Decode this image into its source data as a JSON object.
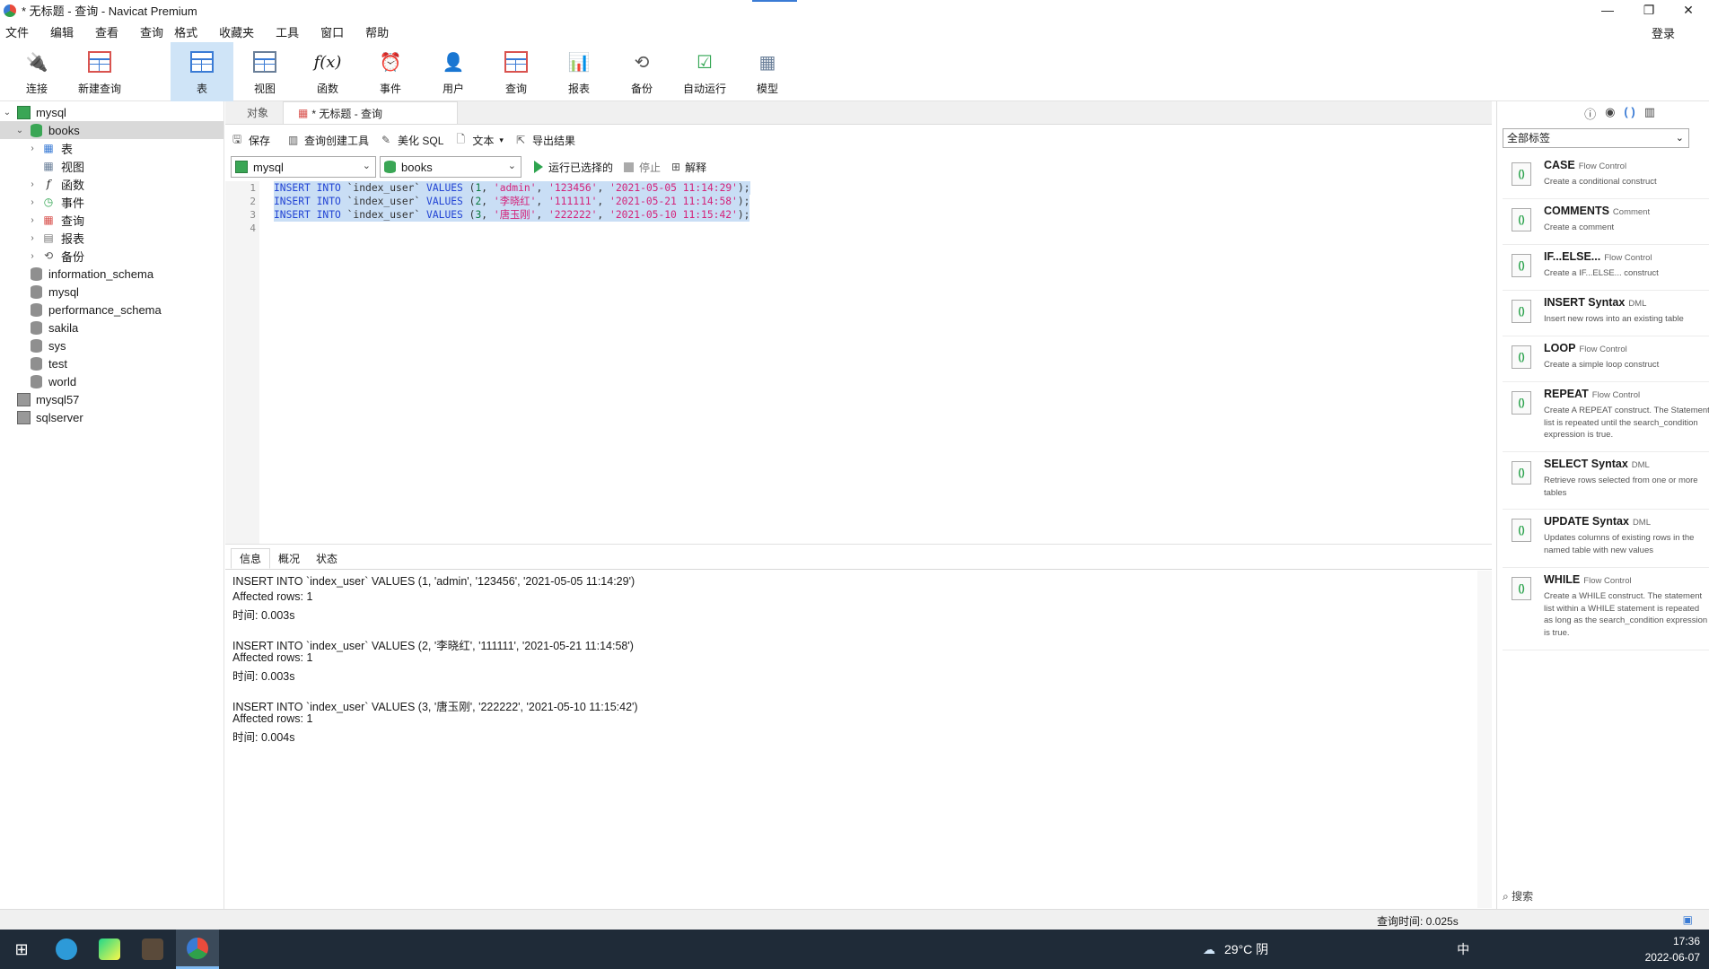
{
  "window": {
    "title": "* 无标题 - 查询 - Navicat Premium",
    "login": "登录",
    "minimize": "—",
    "maximize": "❐",
    "close": "✕"
  },
  "menu": [
    "文件",
    "编辑",
    "查看",
    "查询",
    "格式",
    "收藏夹",
    "工具",
    "窗口",
    "帮助"
  ],
  "toolbar": {
    "connect": "连接",
    "new_query": "新建查询",
    "table": "表",
    "view": "视图",
    "function": "函数",
    "event": "事件",
    "user": "用户",
    "query": "查询",
    "report": "报表",
    "backup": "备份",
    "automation": "自动运行",
    "model": "模型",
    "function_glyph": "f(x)"
  },
  "tree": {
    "conn_mysql": "mysql",
    "db_books": "books",
    "books_children": [
      "表",
      "视图",
      "函数",
      "事件",
      "查询",
      "报表",
      "备份"
    ],
    "other_dbs": [
      "information_schema",
      "mysql",
      "performance_schema",
      "sakila",
      "sys",
      "test",
      "world"
    ],
    "conn_mysql57": "mysql57",
    "conn_sqlserver": "sqlserver"
  },
  "tabs": {
    "objects": "对象",
    "query": "* 无标题 - 查询"
  },
  "query_toolbar": {
    "save": "保存",
    "builder": "查询创建工具",
    "beautify": "美化 SQL",
    "text": "文本",
    "export": "导出结果"
  },
  "selectors": {
    "connection": "mysql",
    "database": "books",
    "run_selected": "运行已选择的",
    "stop": "停止",
    "explain": "解释"
  },
  "editor": {
    "line_numbers": [
      "1",
      "2",
      "3",
      "4"
    ],
    "lines": [
      {
        "kw1": "INSERT INTO",
        "tbl": " `index_user` ",
        "kw2": "VALUES",
        "open": " (",
        "num": "1",
        "c1": ", ",
        "s1": "'admin'",
        "c2": ", ",
        "s2": "'123456'",
        "c3": ", ",
        "s3": "'2021-05-05 11:14:29'",
        "end": ");"
      },
      {
        "kw1": "INSERT INTO",
        "tbl": " `index_user` ",
        "kw2": "VALUES",
        "open": " (",
        "num": "2",
        "c1": ", ",
        "s1": "'李晓红'",
        "c2": ", ",
        "s2": "'111111'",
        "c3": ", ",
        "s3": "'2021-05-21 11:14:58'",
        "end": ");"
      },
      {
        "kw1": "INSERT INTO",
        "tbl": " `index_user` ",
        "kw2": "VALUES",
        "open": " (",
        "num": "3",
        "c1": ", ",
        "s1": "'唐玉刚'",
        "c2": ", ",
        "s2": "'222222'",
        "c3": ", ",
        "s3": "'2021-05-10 11:15:42'",
        "end": ");"
      }
    ]
  },
  "result_tabs": [
    "信息",
    "概况",
    "状态"
  ],
  "results": [
    "INSERT INTO `index_user` VALUES (1, 'admin', '123456', '2021-05-05 11:14:29')",
    "Affected rows: 1",
    "时间: 0.003s",
    "INSERT INTO `index_user` VALUES (2, '李晓红', '111111', '2021-05-21 11:14:58')",
    "Affected rows: 1",
    "时间: 0.003s",
    "INSERT INTO `index_user` VALUES (3, '唐玉刚', '222222', '2021-05-10 11:15:42')",
    "Affected rows: 1",
    "时间: 0.004s"
  ],
  "status": {
    "query_time": "查询时间: 0.025s"
  },
  "right_panel": {
    "dropdown": "全部标签",
    "search": "搜索",
    "snippets": [
      {
        "name": "CASE",
        "cat": "Flow Control",
        "desc": "Create a conditional construct"
      },
      {
        "name": "COMMENTS",
        "cat": "Comment",
        "desc": "Create a comment"
      },
      {
        "name": "IF...ELSE...",
        "cat": "Flow Control",
        "desc": "Create a IF...ELSE... construct"
      },
      {
        "name": "INSERT Syntax",
        "cat": "DML",
        "desc": "Insert new rows into an existing table"
      },
      {
        "name": "LOOP",
        "cat": "Flow Control",
        "desc": "Create a simple loop construct"
      },
      {
        "name": "REPEAT",
        "cat": "Flow Control",
        "desc": "Create A REPEAT construct. The Statement list is repeated until the search_condition expression is true."
      },
      {
        "name": "SELECT Syntax",
        "cat": "DML",
        "desc": "Retrieve rows selected from one or more tables"
      },
      {
        "name": "UPDATE Syntax",
        "cat": "DML",
        "desc": "Updates columns of existing rows in the named table with new values"
      },
      {
        "name": "WHILE",
        "cat": "Flow Control",
        "desc": "Create a WHILE construct. The statement list within a WHILE statement is repeated as long as the search_condition expression is true."
      }
    ]
  },
  "taskbar": {
    "weather": "29°C 阴",
    "ime": "中",
    "time": "17:36",
    "date": "2022-06-07"
  }
}
